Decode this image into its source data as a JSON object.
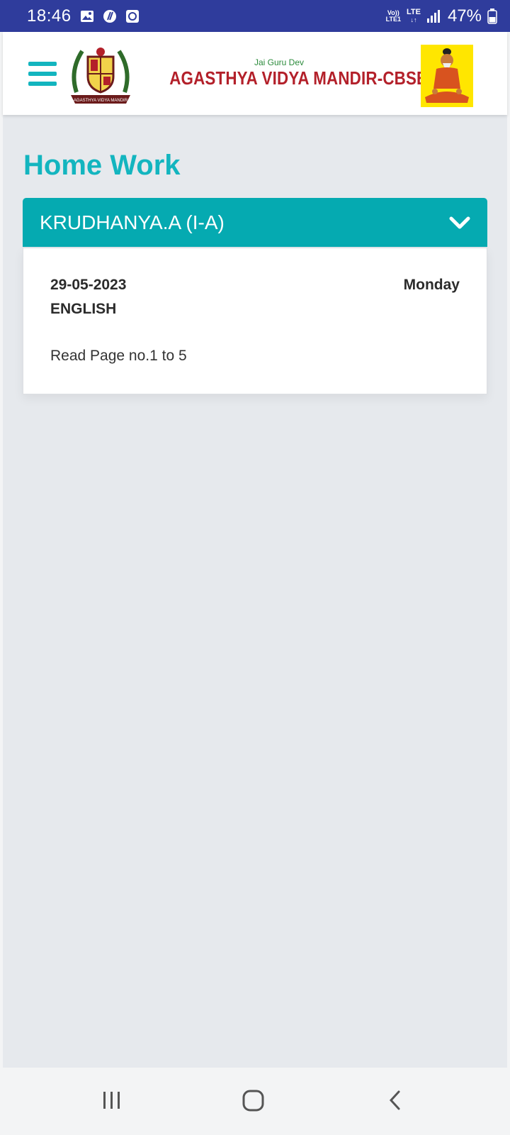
{
  "status_bar": {
    "time": "18:46",
    "network_top": "Vo))",
    "network_bottom": "LTE1",
    "lte_label": "LTE",
    "battery": "47%"
  },
  "header": {
    "brand_subtitle": "Jai Guru Dev",
    "brand_title": "AGASTHYA VIDYA MANDIR-CBSE",
    "crest_text": "AGASTHYA VIDYA MANDIR"
  },
  "page": {
    "title": "Home Work"
  },
  "student_selector": {
    "selected": "KRUDHANYA.A (I-A)"
  },
  "homework": [
    {
      "date": "29-05-2023",
      "day": "Monday",
      "subject": "ENGLISH",
      "description": "Read Page no.1 to 5"
    }
  ],
  "colors": {
    "status_bar": "#2f3c9c",
    "accent": "#13b5bf",
    "selector_bg": "#05aab1",
    "brand_red": "#b3202a"
  },
  "nav_icons": [
    "recent-apps-icon",
    "home-icon",
    "back-icon"
  ]
}
